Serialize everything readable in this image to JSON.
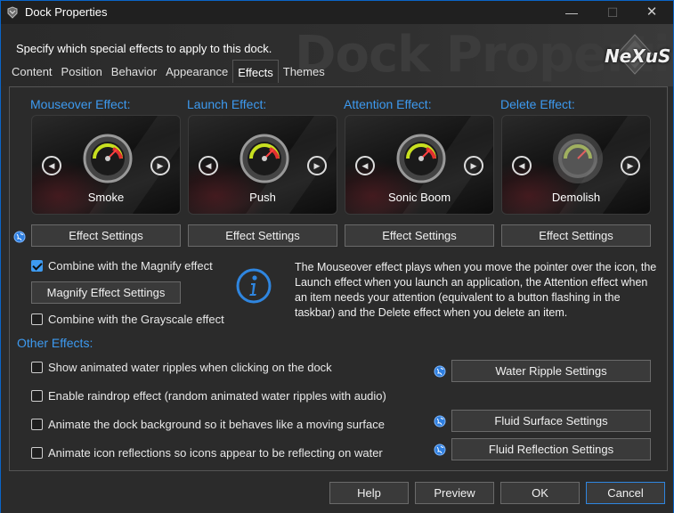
{
  "window": {
    "title": "Dock Properties",
    "icon": "nexus-app-icon",
    "controls": {
      "minimize": "—",
      "maximize": "☐",
      "close": "✕"
    }
  },
  "header": {
    "subtitle": "Specify which special effects to apply to this dock.",
    "watermark": "Dock Properties",
    "logo": "NeXuS"
  },
  "tabs": [
    {
      "label": "Content",
      "active": false
    },
    {
      "label": "Position",
      "active": false
    },
    {
      "label": "Behavior",
      "active": false
    },
    {
      "label": "Appearance",
      "active": false
    },
    {
      "label": "Effects",
      "active": true
    },
    {
      "label": "Themes",
      "active": false
    }
  ],
  "effects": [
    {
      "title": "Mouseover Effect:",
      "selected": "Smoke",
      "settings_label": "Effect Settings"
    },
    {
      "title": "Launch Effect:",
      "selected": "Push",
      "settings_label": "Effect Settings"
    },
    {
      "title": "Attention Effect:",
      "selected": "Sonic Boom",
      "settings_label": "Effect Settings"
    },
    {
      "title": "Delete Effect:",
      "selected": "Demolish",
      "settings_label": "Effect Settings"
    }
  ],
  "magnify": {
    "combine_label": "Combine with the Magnify effect",
    "combine_checked": true,
    "settings_label": "Magnify Effect Settings",
    "grayscale_label": "Combine with the Grayscale effect",
    "grayscale_checked": false
  },
  "info": {
    "text": "The Mouseover effect plays when you move the pointer over the icon, the Launch effect when you launch an application, the Attention effect when an item needs your attention (equivalent to a button flashing in the taskbar) and the Delete effect when you delete an item."
  },
  "other_effects": {
    "title": "Other Effects:",
    "items": [
      {
        "label": "Show animated water ripples when clicking on the dock",
        "checked": false,
        "settings_label": "Water Ripple Settings"
      },
      {
        "label": "Enable raindrop effect (random animated water ripples with audio)",
        "checked": false,
        "settings_label": ""
      },
      {
        "label": "Animate the dock background so it behaves like a moving surface",
        "checked": false,
        "settings_label": "Fluid Surface Settings"
      },
      {
        "label": "Animate icon reflections so icons appear to be reflecting on water",
        "checked": false,
        "settings_label": "Fluid Reflection Settings"
      }
    ]
  },
  "footer": {
    "help": "Help",
    "preview": "Preview",
    "ok": "OK",
    "cancel": "Cancel"
  },
  "colors": {
    "accent": "#3d9af0",
    "background": "#2b2b2b",
    "button": "#3a3a3a"
  }
}
